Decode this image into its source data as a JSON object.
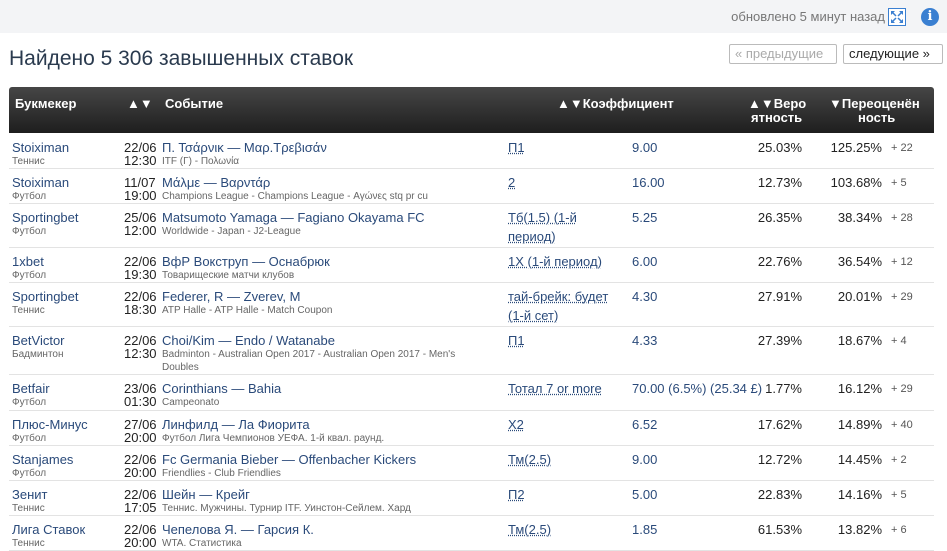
{
  "header": {
    "updated": "обновлено 5 минут назад",
    "title": "Найдено 5 306 завышенных ставок",
    "prev": "« предыдущие",
    "next": "следующие »",
    "info_glyph": "i"
  },
  "columns": {
    "bookmaker": "Букмекер",
    "event_sort": "▲▼",
    "event": "Событие",
    "odds": "▲▼Коэффициент",
    "prob_line1": "▲▼Веро",
    "prob_line2": "ятность",
    "over_line1": "▼Переоценён",
    "over_line2": "ность"
  },
  "rows": [
    {
      "bookmaker": "Stoiximan",
      "sport": "Теннис",
      "date": "22/06",
      "time": "12:30",
      "event": "Π. Τσάρνικ — Μαρ.Τρεβισάν",
      "league": "ITF (Γ) - Πολωνία",
      "bet": "П1",
      "odds": "9.00",
      "prob": "25.03%",
      "over": "125.25%",
      "plus": "+ 22"
    },
    {
      "bookmaker": "Stoiximan",
      "sport": "Футбол",
      "date": "11/07",
      "time": "19:00",
      "event": "Μάλμε — Βαρντάρ",
      "league": "Champions League - Champions League - Αγώνες stq pr cu",
      "bet": "2",
      "odds": "16.00",
      "prob": "12.73%",
      "over": "103.68%",
      "plus": "+ 5"
    },
    {
      "bookmaker": "Sportingbet",
      "sport": "Футбол",
      "date": "25/06",
      "time": "12:00",
      "event": "Matsumoto Yamaga — Fagiano Okayama FC",
      "league": "Worldwide - Japan - J2-League",
      "bet": "Тб(1.5) (1-й период)",
      "odds": "5.25",
      "prob": "26.35%",
      "over": "38.34%",
      "plus": "+ 28"
    },
    {
      "bookmaker": "1xbet",
      "sport": "Футбол",
      "date": "22/06",
      "time": "19:30",
      "event": "ВфР Вокструп — Оснабрюк",
      "league": "Товарищеские матчи клубов",
      "bet": "1Х (1-й период)",
      "odds": "6.00",
      "prob": "22.76%",
      "over": "36.54%",
      "plus": "+ 12"
    },
    {
      "bookmaker": "Sportingbet",
      "sport": "Теннис",
      "date": "22/06",
      "time": "18:30",
      "event": "Federer, R — Zverev, M",
      "league": "ATP Halle - ATP Halle - Match Coupon",
      "bet": "тай-брейк: будет (1-й сет)",
      "odds": "4.30",
      "prob": "27.91%",
      "over": "20.01%",
      "plus": "+ 29"
    },
    {
      "bookmaker": "BetVictor",
      "sport": "Бадминтон",
      "date": "22/06",
      "time": "12:30",
      "event": "Choi/Kim — Endo / Watanabe",
      "league": "Badminton - Australian Open 2017 - Australian Open 2017 - Men's Doubles",
      "bet": "П1",
      "odds": "4.33",
      "prob": "27.39%",
      "over": "18.67%",
      "plus": "+ 4"
    },
    {
      "bookmaker": "Betfair",
      "sport": "Футбол",
      "date": "23/06",
      "time": "01:30",
      "event": "Corinthians — Bahia",
      "league": "Campeonato",
      "bet": "Тотал 7 or more",
      "odds": "70.00 (6.5%) (25.34 £)",
      "prob": "1.77%",
      "over": "16.12%",
      "plus": "+ 29"
    },
    {
      "bookmaker": "Плюс-Минус",
      "sport": "Футбол",
      "date": "27/06",
      "time": "20:00",
      "event": "Линфилд — Ла Фиорита",
      "league": "Футбол Лига Чемпионов УЕФА. 1-й квал. раунд.",
      "bet": "Х2",
      "odds": "6.52",
      "prob": "17.62%",
      "over": "14.89%",
      "plus": "+ 40"
    },
    {
      "bookmaker": "Stanjames",
      "sport": "Футбол",
      "date": "22/06",
      "time": "20:00",
      "event": "Fc Germania Bieber — Offenbacher Kickers",
      "league": "Friendlies - Club Friendlies",
      "bet": "Тм(2.5)",
      "odds": "9.00",
      "prob": "12.72%",
      "over": "14.45%",
      "plus": "+ 2"
    },
    {
      "bookmaker": "Зенит",
      "sport": "Теннис",
      "date": "22/06",
      "time": "17:05",
      "event": "Шейн — Крейг",
      "league": "Теннис. Мужчины. Турнир ITF. Уинстон-Сейлем. Хард",
      "bet": "П2",
      "odds": "5.00",
      "prob": "22.83%",
      "over": "14.16%",
      "plus": "+ 5"
    },
    {
      "bookmaker": "Лига Ставок",
      "sport": "Теннис",
      "date": "22/06",
      "time": "20:00",
      "event": "Чепелова Я. — Гарсия К.",
      "league": "WTA. Статистика",
      "bet": "Тм(2.5)",
      "odds": "1.85",
      "prob": "61.53%",
      "over": "13.82%",
      "plus": "+ 6"
    }
  ]
}
